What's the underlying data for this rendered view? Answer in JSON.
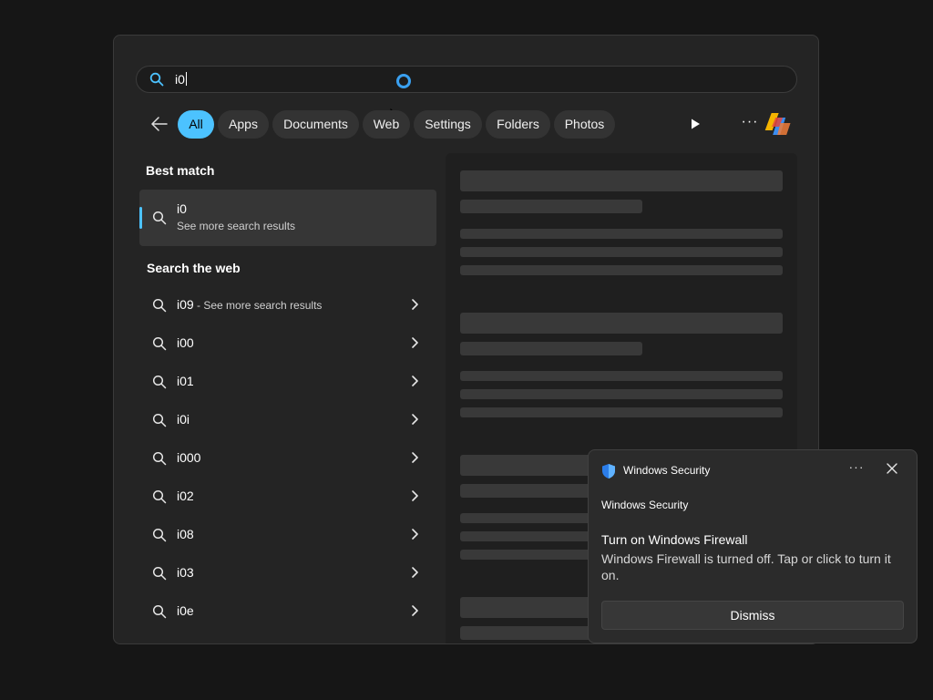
{
  "search": {
    "query": "i0"
  },
  "filters": [
    {
      "label": "All",
      "active": true
    },
    {
      "label": "Apps"
    },
    {
      "label": "Documents"
    },
    {
      "label": "Web"
    },
    {
      "label": "Settings"
    },
    {
      "label": "Folders"
    },
    {
      "label": "Photos"
    }
  ],
  "icons": {
    "search": "search-icon",
    "back": "back-arrow-icon",
    "play": "play-icon",
    "more": "more-icon",
    "copilot": "copilot-icon",
    "chevron": "chevron-right-icon",
    "shield": "shield-icon",
    "close": "close-icon"
  },
  "best_match": {
    "title": "Best match",
    "item_title": "i0",
    "item_subtitle": "See more search results"
  },
  "web": {
    "title": "Search the web",
    "items": [
      {
        "label": "i09",
        "sub": " - See more search results"
      },
      {
        "label": "i00"
      },
      {
        "label": "i01"
      },
      {
        "label": "i0i"
      },
      {
        "label": "i000"
      },
      {
        "label": "i02"
      },
      {
        "label": "i08"
      },
      {
        "label": "i03"
      },
      {
        "label": "i0e"
      }
    ]
  },
  "toast": {
    "app_name": "Windows Security",
    "more": "···",
    "attribution": "Windows Security",
    "heading": "Turn on Windows Firewall",
    "body": "Windows Firewall is turned off. Tap or click to turn it on.",
    "dismiss": "Dismiss"
  },
  "colors": {
    "accent": "#4cc2ff",
    "panel": "#242424",
    "background": "#161616"
  }
}
